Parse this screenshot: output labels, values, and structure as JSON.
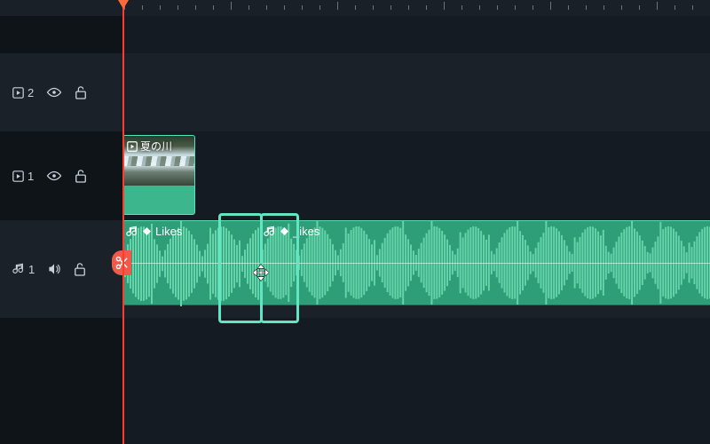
{
  "tracks": {
    "video2": {
      "kind_icon": "play",
      "number": "2"
    },
    "video1": {
      "kind_icon": "play",
      "number": "1",
      "clip": {
        "title": "夏の川"
      }
    },
    "audio1": {
      "kind_icon": "music",
      "number": "1",
      "clip1": {
        "title": "Likes"
      },
      "clip2": {
        "title": "_ikes"
      }
    }
  }
}
